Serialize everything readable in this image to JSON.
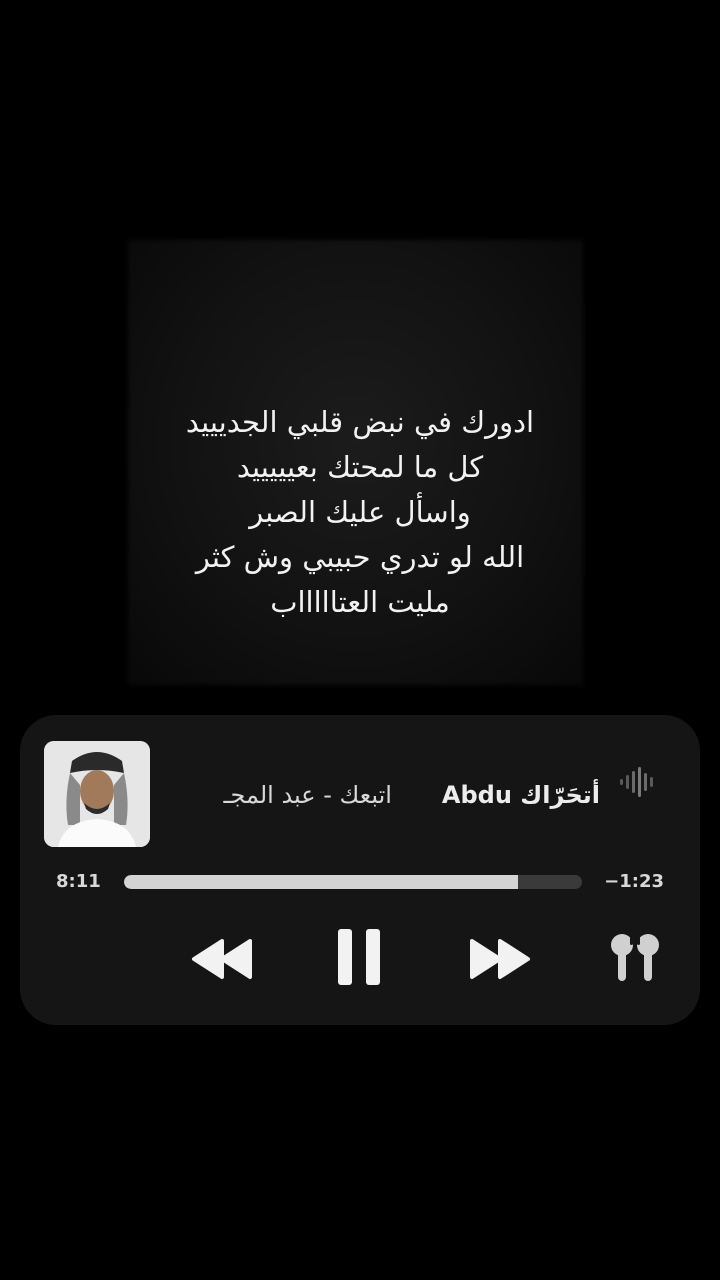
{
  "lyrics": {
    "lines": [
      "ادورك في نبض قلبي الجديييد",
      "كل ما لمحتك بعيييييد",
      "واسأل عليك الصبر",
      "الله لو تدري حبيبي وش كثر",
      "مليت العتاااااب"
    ]
  },
  "player": {
    "title_primary": "أتحَرّاك Abdu",
    "title_secondary": "اتبعك - عبد المجـ",
    "elapsed": "8:11",
    "remaining": "−1:23",
    "progress_fraction": 0.86,
    "icons": {
      "artwork": "album-artwork",
      "wave": "audio-wave-icon",
      "rewind": "rewind-icon",
      "pause": "pause-icon",
      "forward": "fast-forward-icon",
      "airpods": "airpods-icon"
    },
    "colors": {
      "background": "#000000",
      "card": "#151515",
      "progress_fill": "#d4d4d4",
      "progress_track": "#3a3a3a"
    }
  }
}
